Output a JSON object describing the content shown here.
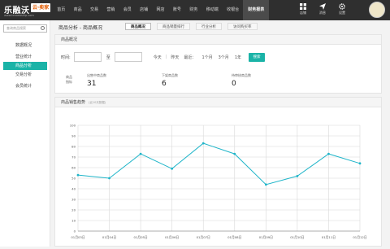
{
  "brand": {
    "name": "乐融沃",
    "badge": "云·卖家",
    "url": "www.lerowoship.com"
  },
  "nav": [
    "首页",
    "商品",
    "交易",
    "营销",
    "会员",
    "店铺",
    "网店",
    "账号",
    "财务",
    "移动端",
    "收银台",
    "财务报表"
  ],
  "nav_active": 11,
  "tools": [
    {
      "icon": "grid-icon",
      "label": "店铺"
    },
    {
      "icon": "send-icon",
      "label": "消息"
    },
    {
      "icon": "gear-icon",
      "label": "设置"
    }
  ],
  "sidebar": {
    "search_placeholder": "查询商品搜索",
    "items": [
      {
        "label": "数据概况",
        "active": false
      },
      {
        "label": "营业统计",
        "active": false
      },
      {
        "label": "商品分析",
        "active": true
      },
      {
        "label": "交易分析",
        "active": false
      },
      {
        "label": "会员统计",
        "active": false
      }
    ]
  },
  "page_title": "商品分析 - 商品概况",
  "tabs": [
    {
      "label": "商品概况",
      "active": true
    },
    {
      "label": "商品销量排行",
      "active": false
    },
    {
      "label": "行业分析",
      "active": false
    },
    {
      "label": "访问购买率",
      "active": false
    }
  ],
  "overview": {
    "header": "商品概况",
    "time_label": "时间:",
    "to_label": "至",
    "links": [
      "今天",
      "昨天",
      "最近：",
      "1个月",
      "3个月",
      "1年"
    ],
    "query_button": "搜索",
    "section_label": [
      "商品",
      "指标"
    ],
    "stats": [
      {
        "label": "出售中商品数",
        "value": "31"
      },
      {
        "label": "下架商品数",
        "value": "6"
      },
      {
        "label": "待审核商品数",
        "value": "0"
      }
    ]
  },
  "chart_panel": {
    "header": "商品销售趋势",
    "subtitle": "(近10天数据)"
  },
  "chart_data": {
    "type": "line",
    "categories": [
      "01月03日",
      "01月04日",
      "01月05日",
      "01月06日",
      "01月07日",
      "01月08日",
      "01月09日",
      "01月10日",
      "01月11日",
      "01月12日"
    ],
    "series": [
      {
        "values": [
          53,
          50,
          73,
          59,
          83,
          73,
          44,
          52,
          73,
          64
        ]
      }
    ],
    "ylim": [
      0,
      100
    ],
    "yticks": [
      0,
      10,
      20,
      30,
      40,
      50,
      60,
      70,
      80,
      90,
      100
    ],
    "grid": true,
    "color": "#1fb5c9"
  }
}
